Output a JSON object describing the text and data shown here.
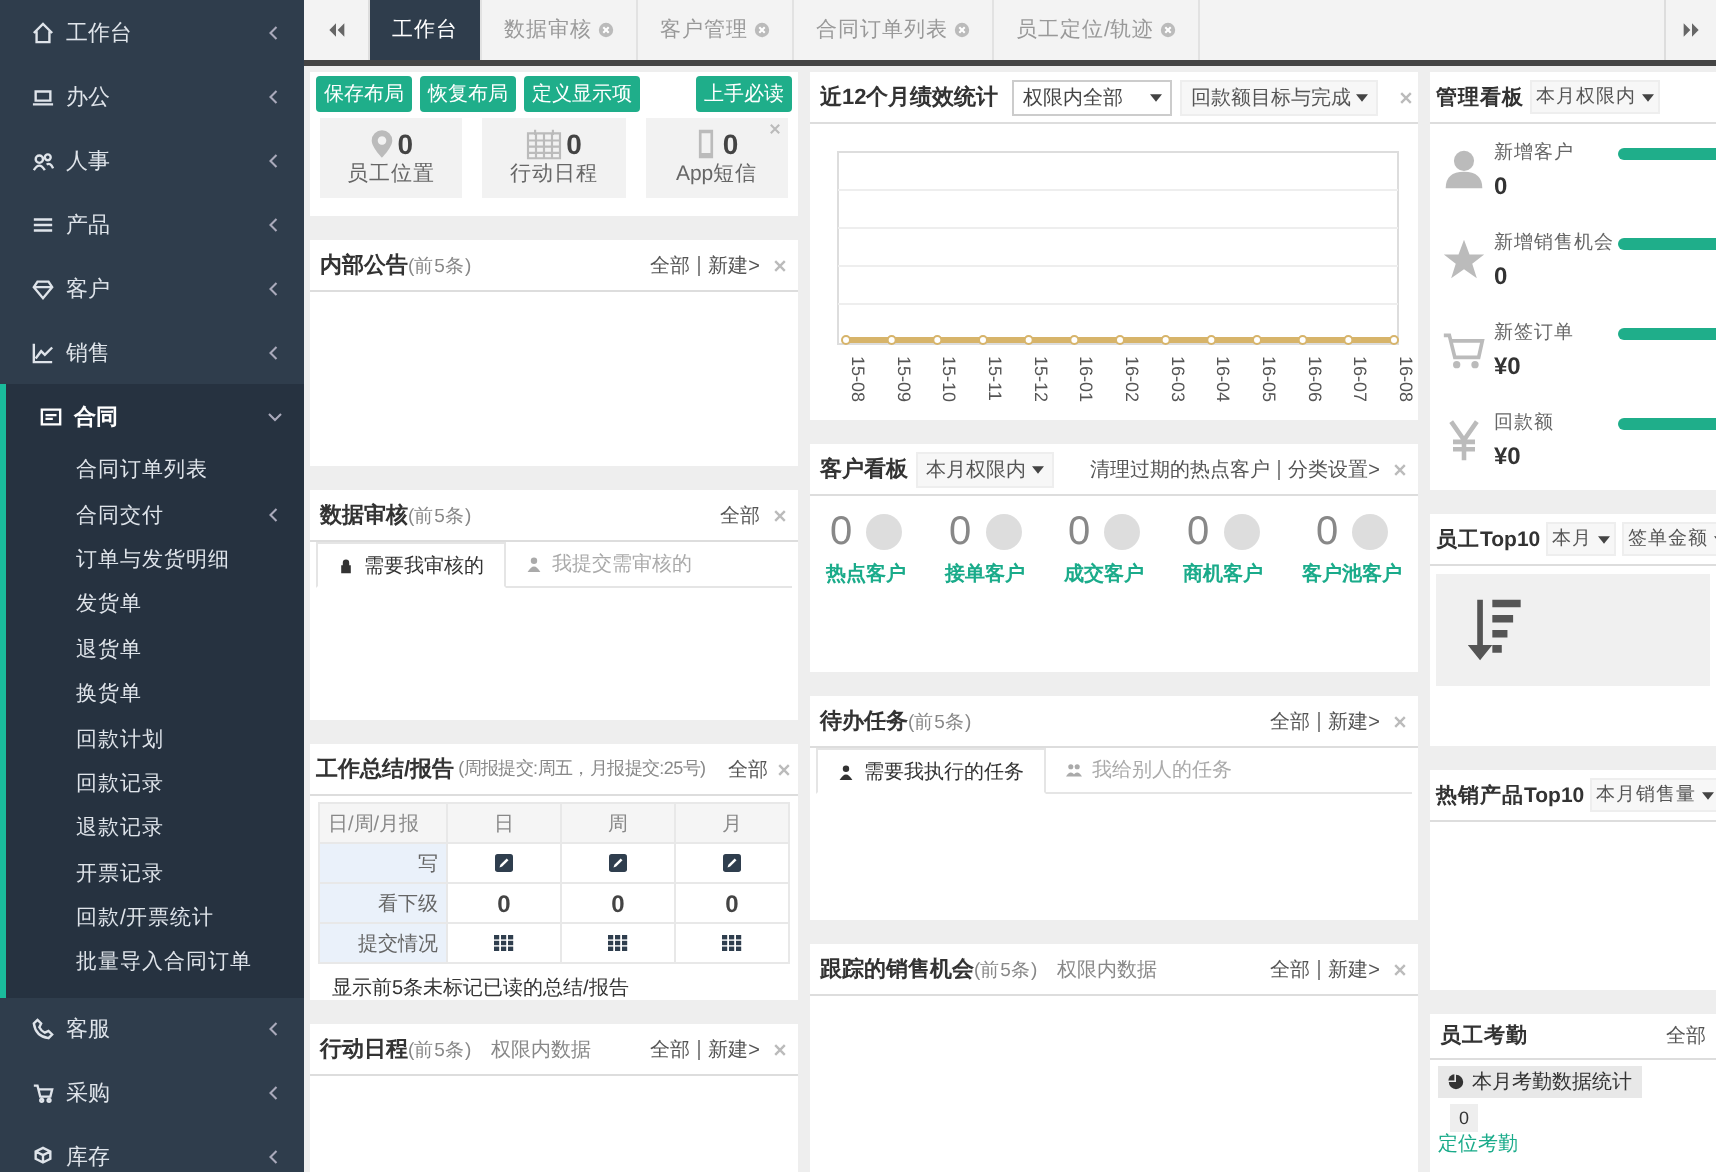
{
  "sidebar": {
    "items": [
      {
        "label": "工作台",
        "expanded": false
      },
      {
        "label": "办公",
        "expanded": false
      },
      {
        "label": "人事",
        "expanded": false
      },
      {
        "label": "产品",
        "expanded": false
      },
      {
        "label": "客户",
        "expanded": false
      },
      {
        "label": "销售",
        "expanded": false
      },
      {
        "label": "合同",
        "expanded": true,
        "children": [
          {
            "label": "合同订单列表",
            "kind": "link"
          },
          {
            "label": "合同交付",
            "kind": "group"
          },
          {
            "label": "订单与发货明细",
            "kind": "link"
          },
          {
            "label": "发货单",
            "kind": "link"
          },
          {
            "label": "退货单",
            "kind": "link"
          },
          {
            "label": "换货单",
            "kind": "link"
          },
          {
            "label": "回款计划",
            "kind": "link"
          },
          {
            "label": "回款记录",
            "kind": "link"
          },
          {
            "label": "退款记录",
            "kind": "link"
          },
          {
            "label": "开票记录",
            "kind": "link"
          },
          {
            "label": "回款/开票统计",
            "kind": "link"
          },
          {
            "label": "批量导入合同订单",
            "kind": "link"
          }
        ]
      },
      {
        "label": "客服",
        "expanded": false
      },
      {
        "label": "采购",
        "expanded": false
      },
      {
        "label": "库存",
        "expanded": false
      }
    ]
  },
  "tabs": [
    {
      "label": "工作台",
      "selected": true,
      "closable": false
    },
    {
      "label": "数据审核",
      "selected": false,
      "closable": true
    },
    {
      "label": "客户管理",
      "selected": false,
      "closable": true
    },
    {
      "label": "合同订单列表",
      "selected": false,
      "closable": true
    },
    {
      "label": "员工定位/轨迹",
      "selected": false,
      "closable": true
    }
  ],
  "toolbar": {
    "buttons": [
      "保存布局",
      "恢复布局",
      "定义显示项"
    ],
    "guide_button": "上手必读"
  },
  "quick_stats": [
    {
      "label": "员工位置",
      "value": "0"
    },
    {
      "label": "行动日程",
      "value": "0"
    },
    {
      "label": "App短信",
      "value": "0"
    }
  ],
  "notices": {
    "title": "内部公告",
    "note": "(前5条)",
    "links": [
      "全部",
      "新建>"
    ]
  },
  "approvals": {
    "title": "数据审核",
    "note": "(前5条)",
    "links": [
      "全部"
    ],
    "tabs": [
      {
        "label": "需要我审核的",
        "selected": true
      },
      {
        "label": "我提交需审核的",
        "selected": false
      }
    ]
  },
  "reports": {
    "title": "工作总结/报告",
    "note": "(周报提交:周五，月报提交:25号)",
    "links": [
      "全部"
    ],
    "columns": [
      "日/周/月报",
      "日",
      "周",
      "月"
    ],
    "rows": [
      {
        "label": "写",
        "kind": "edit"
      },
      {
        "label": "看下级",
        "kind": "count",
        "values": [
          "0",
          "0",
          "0"
        ]
      },
      {
        "label": "提交情况",
        "kind": "grid"
      }
    ],
    "footer": "显示前5条未标记已读的总结/报告"
  },
  "schedule": {
    "title": "行动日程",
    "note": "(前5条)",
    "scope": "权限内数据",
    "links": [
      "全部",
      "新建>"
    ]
  },
  "performance": {
    "title": "近12个月绩效统计",
    "scope_select": "权限内全部",
    "metric_dropdown": "回款额目标与完成",
    "x_labels": [
      "15-08",
      "15-09",
      "15-10",
      "15-11",
      "15-12",
      "16-01",
      "16-02",
      "16-03",
      "16-04",
      "16-05",
      "16-06",
      "16-07",
      "16-08"
    ]
  },
  "customer_board": {
    "title": "客户看板",
    "period_dropdown": "本月权限内",
    "links": [
      "清理过期的热点客户",
      "分类设置>"
    ],
    "stats": [
      {
        "value": "0",
        "label": "热点客户"
      },
      {
        "value": "0",
        "label": "接单客户"
      },
      {
        "value": "0",
        "label": "成交客户"
      },
      {
        "value": "0",
        "label": "商机客户"
      },
      {
        "value": "0",
        "label": "客户池客户"
      }
    ]
  },
  "tasks": {
    "title": "待办任务",
    "note": "(前5条)",
    "links": [
      "全部",
      "新建>"
    ],
    "tabs": [
      {
        "label": "需要我执行的任务",
        "selected": true
      },
      {
        "label": "我给别人的任务",
        "selected": false
      }
    ]
  },
  "opportunities": {
    "title": "跟踪的销售机会",
    "note": "(前5条)",
    "scope": "权限内数据",
    "links": [
      "全部",
      "新建>"
    ]
  },
  "management_board": {
    "title": "管理看板",
    "period_dropdown": "本月权限内",
    "items": [
      {
        "label": "新增客户",
        "value": "0",
        "level": 1
      },
      {
        "label": "新增销售机会",
        "value": "0",
        "level": 1
      },
      {
        "label": "新签订单",
        "value": "¥0",
        "level": 1
      },
      {
        "label": "回款额",
        "value": "¥0",
        "level": 1
      }
    ]
  },
  "top_staff": {
    "title": "员工Top10",
    "dropdowns": [
      "本月",
      "签单金额"
    ]
  },
  "top_products": {
    "title": "热销产品Top10",
    "dropdowns": [
      "本月销售量"
    ]
  },
  "attendance": {
    "title": "员工考勤",
    "links": [
      "全部"
    ],
    "chip": "本月考勤数据统计",
    "count": "0",
    "link": "定位考勤"
  }
}
